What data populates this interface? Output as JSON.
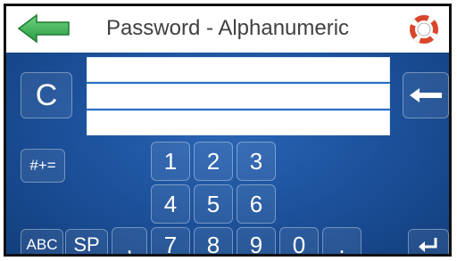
{
  "header": {
    "title": "Password - Alphanumeric",
    "back_icon": "arrow-left-green-icon",
    "help_icon": "lifebuoy-icon"
  },
  "input_fields": [
    {
      "value": ""
    },
    {
      "value": ""
    },
    {
      "value": ""
    }
  ],
  "keys": {
    "clear": "C",
    "symbols": "#+=",
    "abc": "ABC",
    "space": "SP",
    "comma": ",",
    "dot": ".",
    "digits": [
      "1",
      "2",
      "3",
      "4",
      "5",
      "6",
      "7",
      "8",
      "9",
      "0"
    ],
    "backspace_icon": "arrow-left-icon",
    "enter_icon": "enter-return-icon"
  },
  "colors": {
    "panel_blue": "#1b4f98",
    "back_arrow_green": "#2fa84f",
    "help_ring_red": "#d9472b"
  }
}
